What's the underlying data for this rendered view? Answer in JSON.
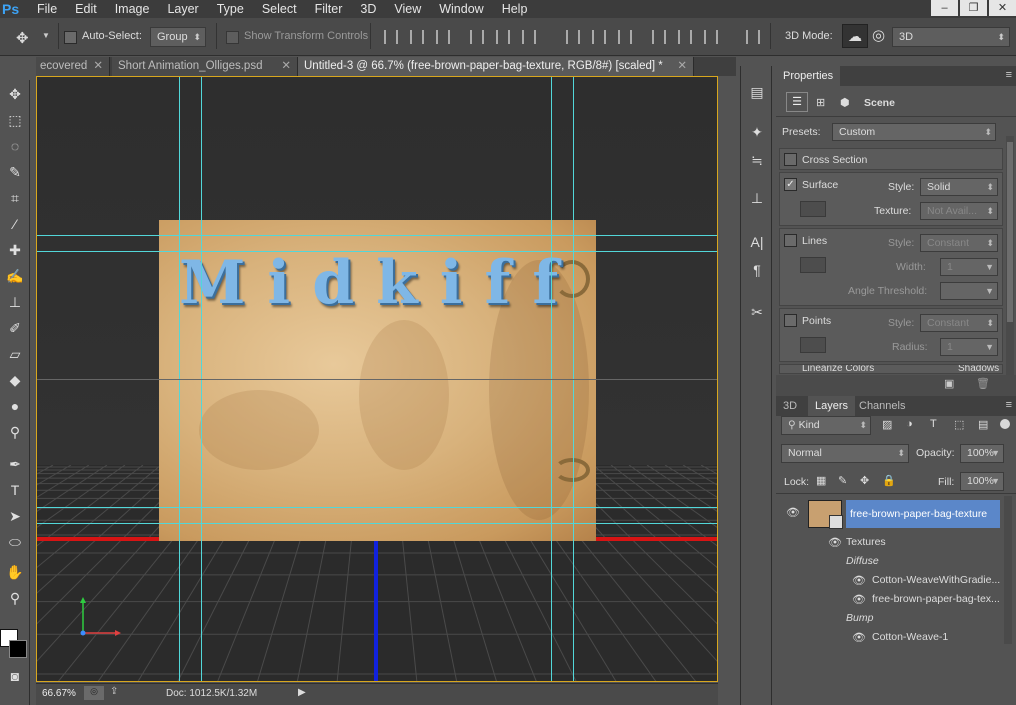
{
  "app": {
    "logo": "Ps"
  },
  "menu": [
    "File",
    "Edit",
    "Image",
    "Layer",
    "Type",
    "Select",
    "Filter",
    "3D",
    "View",
    "Window",
    "Help"
  ],
  "window_controls": [
    "–",
    "❐",
    "✕"
  ],
  "options": {
    "auto_select_label": "Auto-Select:",
    "auto_select_value": "Group",
    "transform_label": "Show Transform Controls",
    "mode_label": "3D Mode:",
    "mode_value": "3D"
  },
  "tabs": [
    {
      "label": "ecovered",
      "close": "✕"
    },
    {
      "label": "Short Animation_Olliges.psd",
      "close": "✕"
    },
    {
      "label": "Untitled-3 @ 66.7% (free-brown-paper-bag-texture, RGB/8#) [scaled] *",
      "close": "✕"
    }
  ],
  "canvas": {
    "text": "Midkiff"
  },
  "status": {
    "zoom": "66.67%",
    "doc": "Doc: 1012.5K/1.32M"
  },
  "properties": {
    "title": "Properties",
    "header_label": "Scene",
    "presets_label": "Presets:",
    "presets_value": "Custom",
    "cross_section": "Cross Section",
    "surface": {
      "label": "Surface",
      "checked": true,
      "style_label": "Style:",
      "style_value": "Solid",
      "texture_label": "Texture:",
      "texture_value": "Not Avail..."
    },
    "lines": {
      "label": "Lines",
      "style_label": "Style:",
      "style_value": "Constant",
      "width_label": "Width:",
      "width_value": "1",
      "angle_label": "Angle Threshold:"
    },
    "points": {
      "label": "Points",
      "style_label": "Style:",
      "style_value": "Constant",
      "radius_label": "Radius:",
      "radius_value": "1"
    },
    "cut_a": "Linearize Colors",
    "cut_b": "Shadows"
  },
  "layers_panel": {
    "tabs": [
      "3D",
      "Layers",
      "Channels"
    ],
    "filter_value": "Kind",
    "blend_mode": "Normal",
    "opacity_label": "Opacity:",
    "opacity_value": "100%",
    "lock_label": "Lock:",
    "fill_label": "Fill:",
    "fill_value": "100%",
    "layer_name": "free-brown-paper-bag-texture",
    "textures_label": "Textures",
    "diffuse_label": "Diffuse",
    "diffuse_items": [
      "Cotton-WeaveWithGradie...",
      "free-brown-paper-bag-tex..."
    ],
    "bump_label": "Bump",
    "bump_items": [
      "Cotton-Weave-1"
    ]
  },
  "colors": {
    "accent_guide": "#52d7d9",
    "canvas_border": "#d8a71e",
    "selected_layer": "#5b87c9"
  }
}
